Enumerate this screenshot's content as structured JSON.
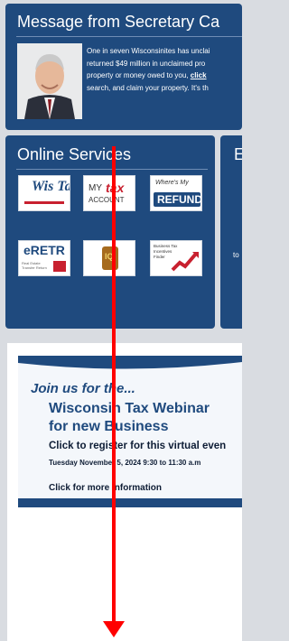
{
  "message_panel": {
    "title": "Message from Secretary Ca",
    "lines": [
      "One in seven Wisconsinites has unclai",
      "returned $49 million in unclaimed pro",
      "property or money owed to you,",
      "search, and claim your property. It's th"
    ],
    "link_text": "click"
  },
  "services": {
    "title": "Online Services",
    "tiles": [
      {
        "id": "wistax",
        "label": "Wis Tax"
      },
      {
        "id": "mytax",
        "label_a": "MY",
        "label_b": "tax",
        "label_c": "ACCOUNT"
      },
      {
        "id": "refund",
        "label_a": "Where's My",
        "label_b": "REFUND"
      },
      {
        "id": "eretr",
        "label_a": "eRETR",
        "label_b": "Real Estate Transfer Return"
      },
      {
        "id": "iq",
        "label": "IQ"
      },
      {
        "id": "incentive",
        "label": "Business Tax Incentives Finder"
      }
    ]
  },
  "side_panel": {
    "letter": "E",
    "small": "to"
  },
  "webinar": {
    "join": "Join us for the...",
    "title_line1": "Wisconsin Tax Webinar",
    "title_line2": "for new Business",
    "register": "Click to register for this virtual even",
    "date": "Tuesday November 5, 2024   9:30 to 11:30 a.m",
    "more": "Click for more information"
  },
  "colors": {
    "panel_blue": "#1f4a7e",
    "arrow_red": "#ff0000",
    "page_gray": "#d9dce1"
  }
}
